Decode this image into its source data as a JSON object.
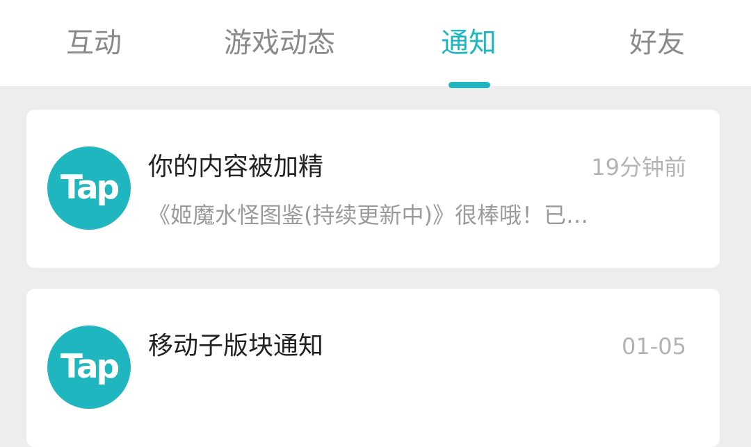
{
  "tabs": [
    {
      "label": "互动",
      "active": false
    },
    {
      "label": "游戏动态",
      "active": false
    },
    {
      "label": "通知",
      "active": true
    },
    {
      "label": "好友",
      "active": false
    }
  ],
  "colors": {
    "accent": "#1fb6c0",
    "background": "#ededed",
    "card": "#ffffff"
  },
  "notifications": [
    {
      "avatar_text": "Tap",
      "title": "你的内容被加精",
      "time": "19分钟前",
      "preview": "《姬魔水怪图鉴(持续更新中)》很棒哦！已…"
    },
    {
      "avatar_text": "Tap",
      "title": "移动子版块通知",
      "time": "01-05",
      "preview": ""
    }
  ]
}
